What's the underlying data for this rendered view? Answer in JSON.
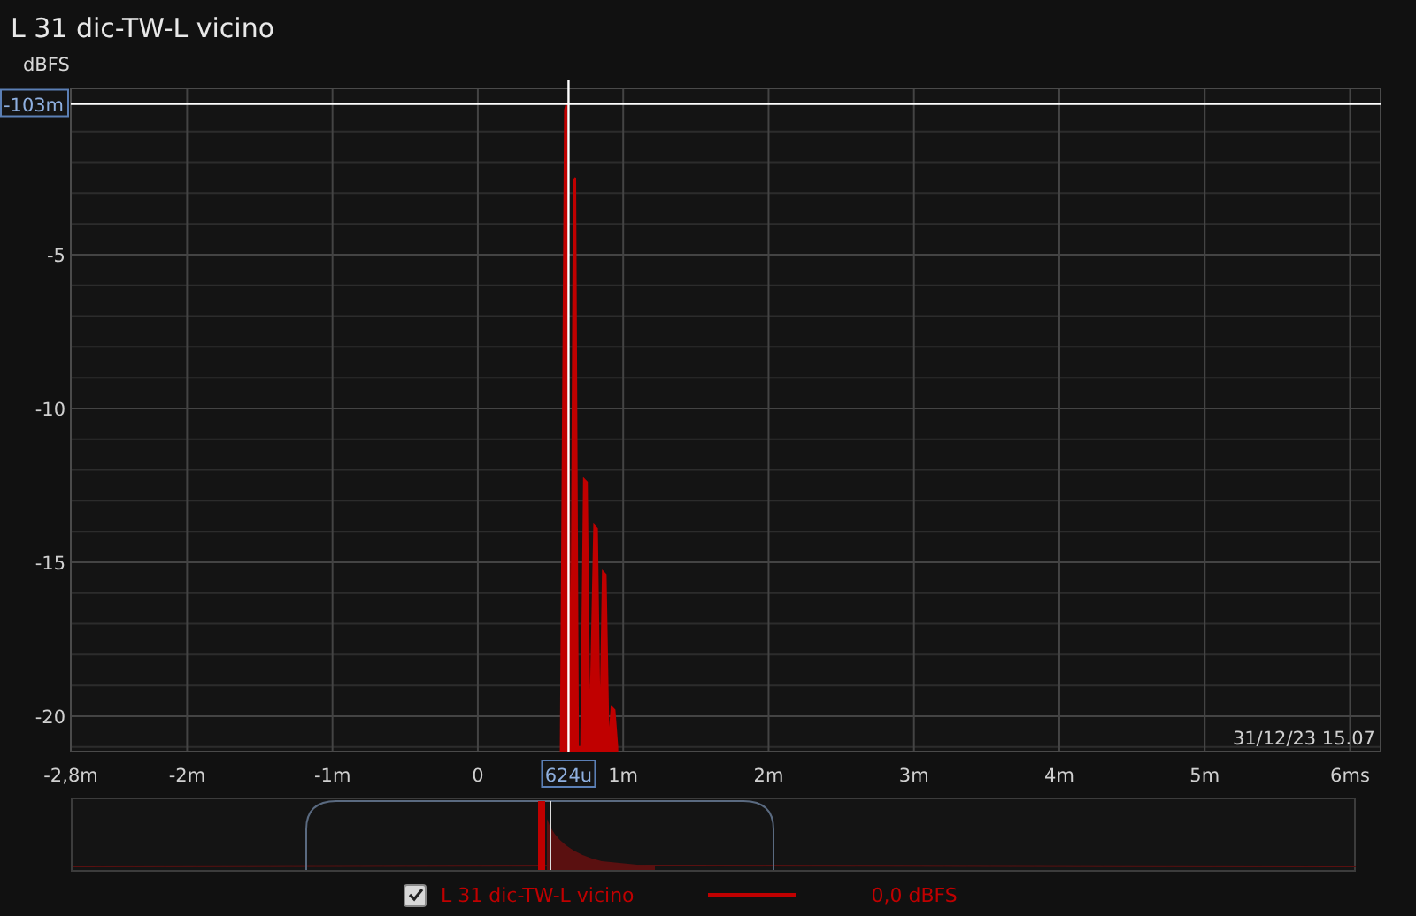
{
  "window": {
    "title": "L 31 dic-TW-L vicino"
  },
  "plot": {
    "y_unit": "dBFS",
    "timestamp": "31/12/23 15.07",
    "chart_data": {
      "type": "area",
      "xlim": [
        -2.8,
        6.21
      ],
      "ylim": [
        -21.15,
        0.4
      ],
      "xticks": [
        {
          "value": -2.8,
          "label": "-2,8m"
        },
        {
          "value": -2,
          "label": "-2m"
        },
        {
          "value": -1,
          "label": "-1m"
        },
        {
          "value": 0,
          "label": "0"
        },
        {
          "value": 1,
          "label": "1m"
        },
        {
          "value": 2,
          "label": "2m"
        },
        {
          "value": 3,
          "label": "3m"
        },
        {
          "value": 4,
          "label": "4m"
        },
        {
          "value": 5,
          "label": "5m"
        },
        {
          "value": 6,
          "label": "6ms"
        }
      ],
      "yticks": [
        -5,
        -10,
        -15,
        -20
      ],
      "x": [
        0.57,
        0.6,
        0.61,
        0.64,
        0.66,
        0.67,
        0.69,
        0.71,
        0.73,
        0.75,
        0.77,
        0.8,
        0.82,
        0.84,
        0.86,
        0.88,
        0.9,
        0.92,
        0.94,
        0.96
      ],
      "series": [
        {
          "name": "L 31 dic-TW-L vicino",
          "color": "#c00000",
          "values": [
            -21,
            -0.3,
            -0.1,
            -21,
            -2.6,
            -2.5,
            -21,
            -21,
            -12.3,
            -12.4,
            -21,
            -13.8,
            -13.9,
            -21,
            -15.3,
            -15.4,
            -21,
            -19.7,
            -19.8,
            -21
          ]
        }
      ],
      "grid": true,
      "ref_lines": [
        {
          "axis": "x",
          "value": 0.624,
          "label": "624u"
        },
        {
          "axis": "y",
          "value": -0.103,
          "label": "-103m"
        }
      ]
    }
  },
  "legend": {
    "checked": true,
    "value": "0,0 dBFS"
  }
}
